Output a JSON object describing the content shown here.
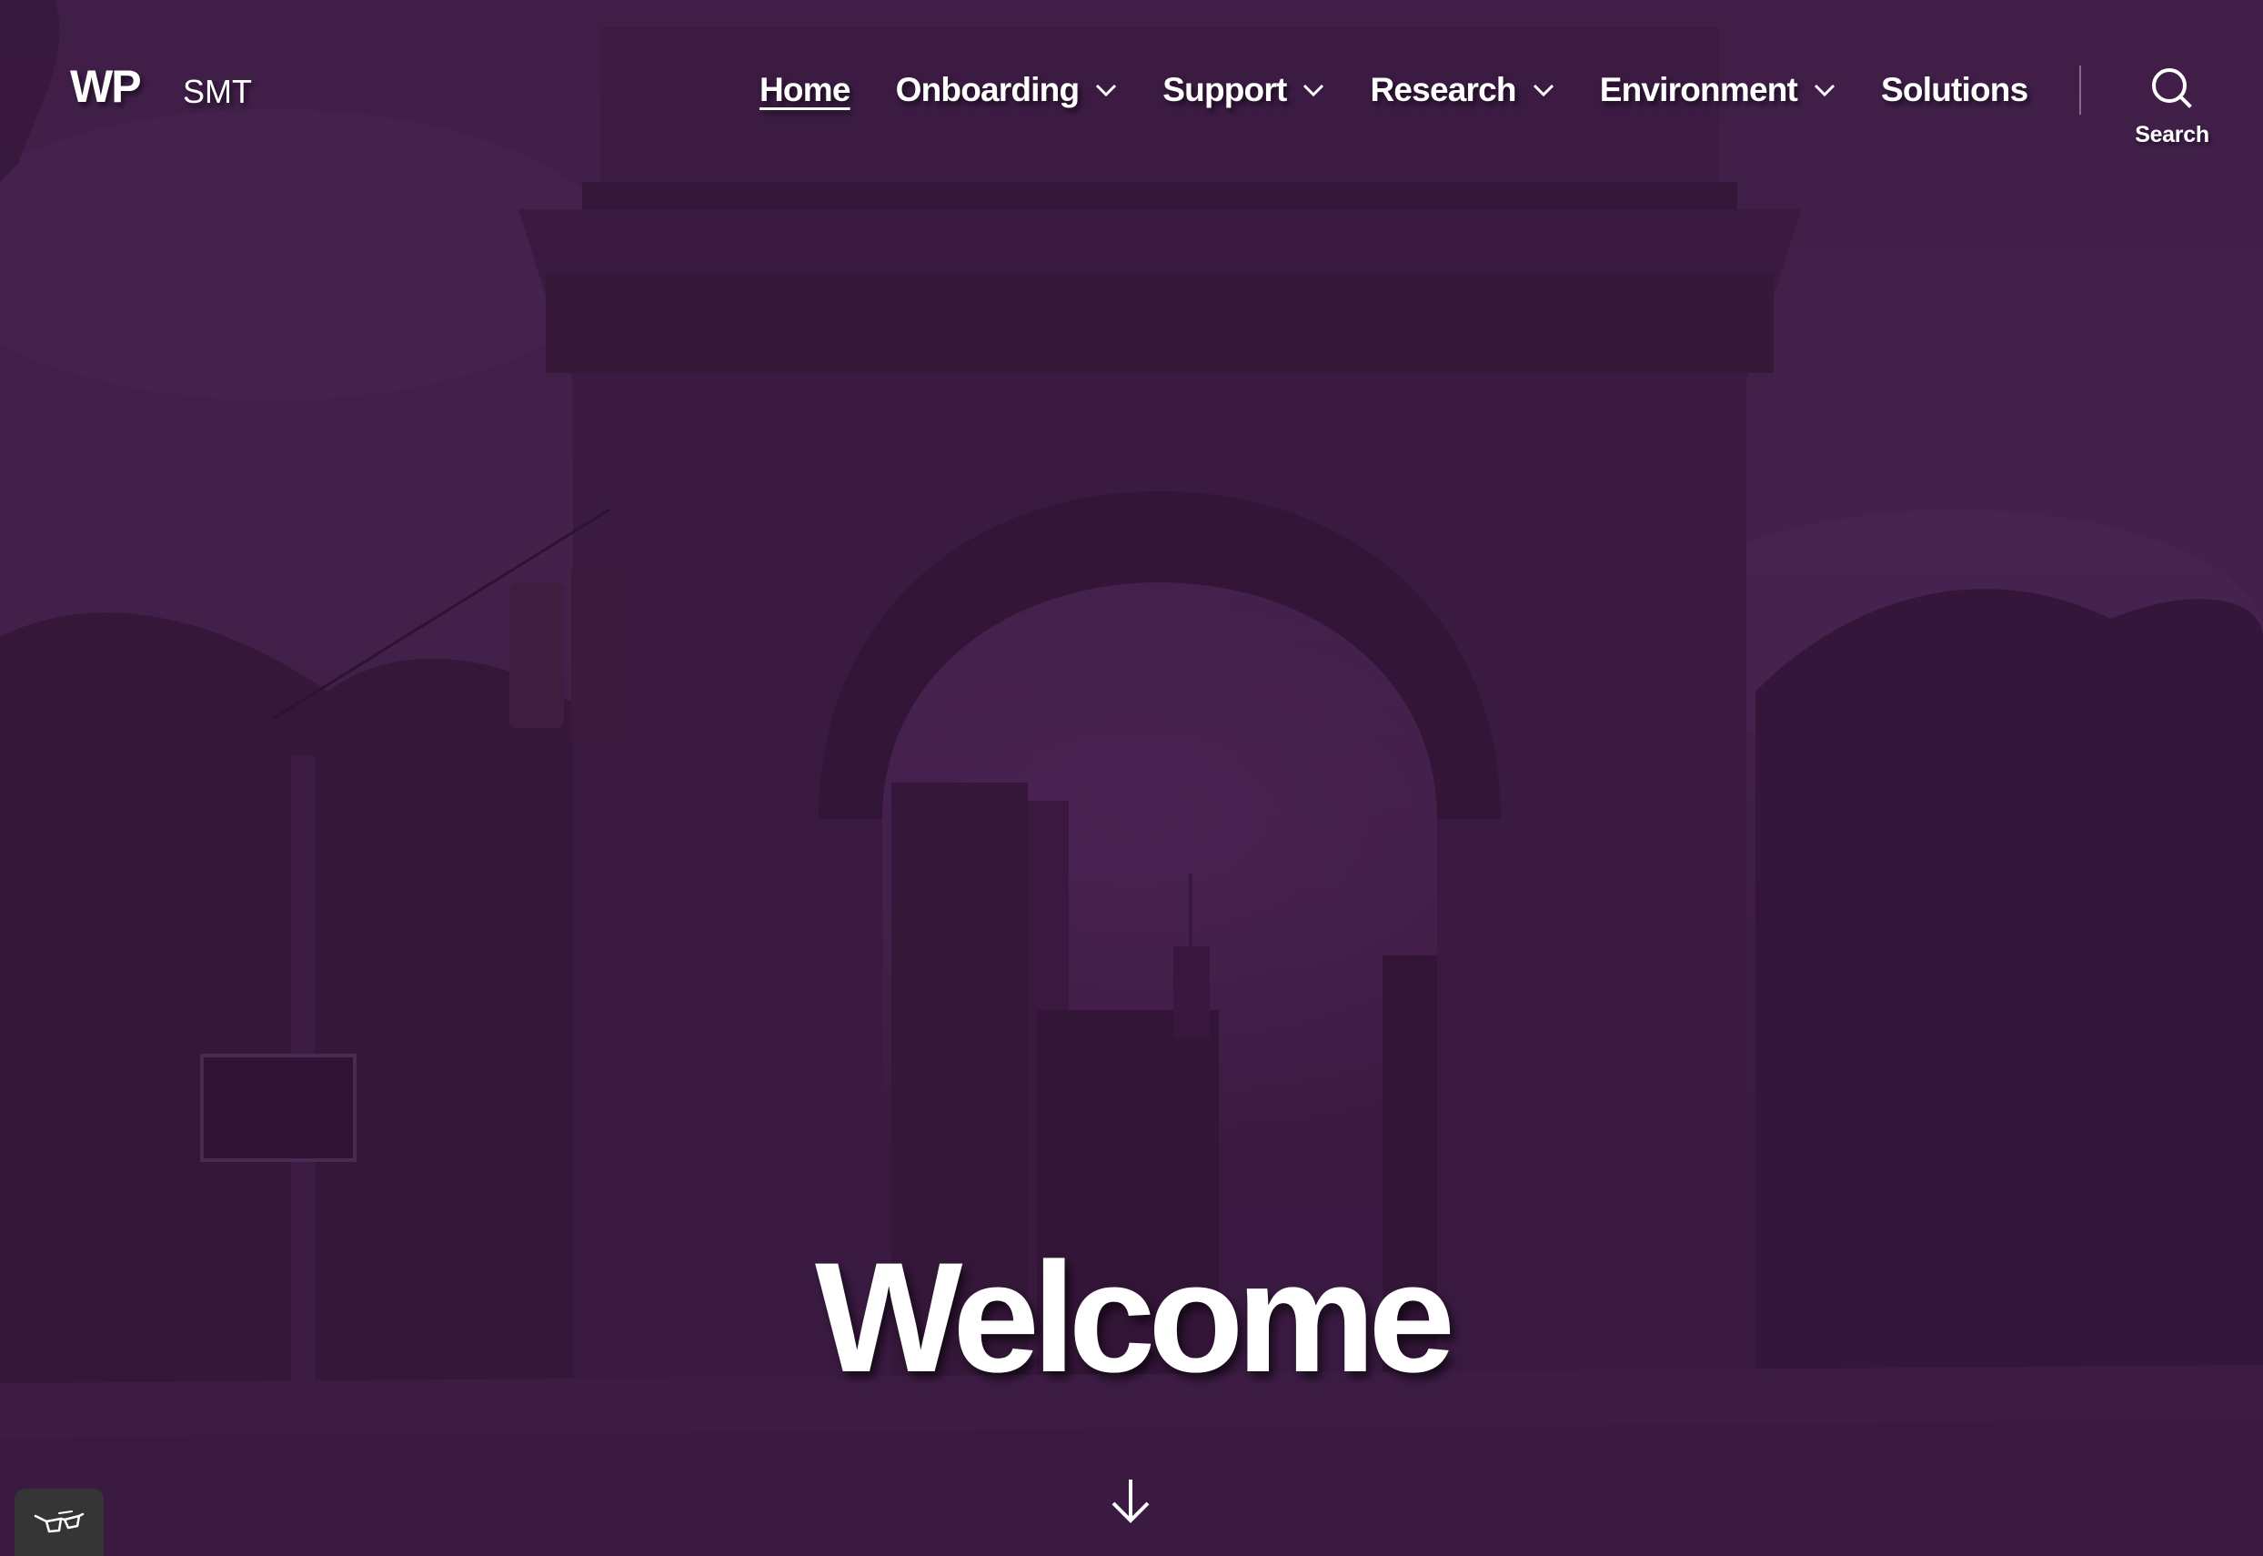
{
  "site": {
    "title": "WP",
    "description": "SMT"
  },
  "nav": {
    "items": [
      {
        "label": "Home",
        "current": true,
        "has_submenu": false
      },
      {
        "label": "Onboarding",
        "current": false,
        "has_submenu": true
      },
      {
        "label": "Support",
        "current": false,
        "has_submenu": true
      },
      {
        "label": "Research",
        "current": false,
        "has_submenu": true
      },
      {
        "label": "Environment",
        "current": false,
        "has_submenu": true
      },
      {
        "label": "Solutions",
        "current": false,
        "has_submenu": false
      }
    ]
  },
  "search": {
    "label": "Search",
    "icon": "search-icon"
  },
  "hero": {
    "title": "Welcome",
    "scroll_icon": "arrow-down-icon",
    "overlay_color": "#3f1d47"
  },
  "accessibility": {
    "icon": "glasses-icon",
    "button_color": "#353535"
  }
}
